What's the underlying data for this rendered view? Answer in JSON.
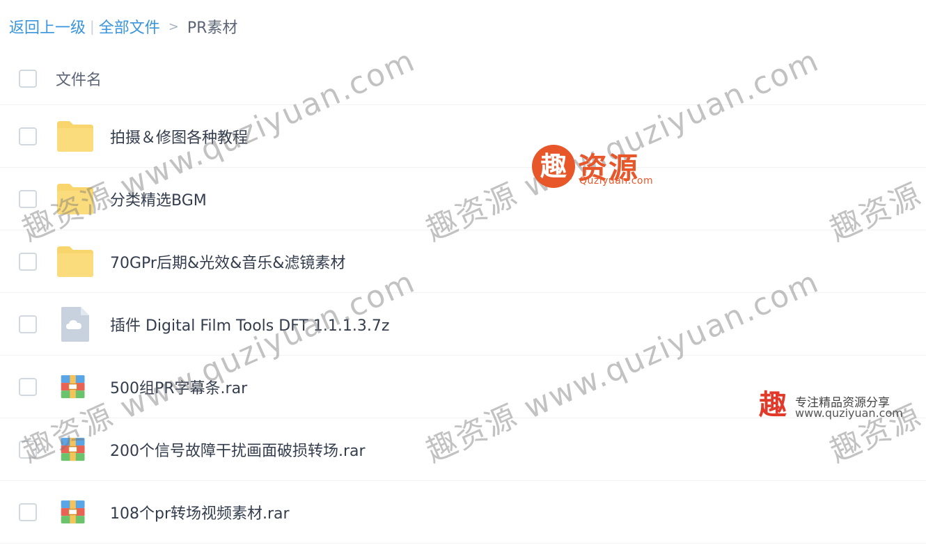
{
  "breadcrumb": {
    "back": "返回上一级",
    "divider": "|",
    "all_files": "全部文件",
    "arrow": ">",
    "current": "PR素材"
  },
  "header": {
    "column_name": "文件名"
  },
  "files": [
    {
      "name": "拍摄＆修图各种教程",
      "type": "folder"
    },
    {
      "name": "分类精选BGM",
      "type": "folder"
    },
    {
      "name": "70GPr后期&光效&音乐&滤镜素材",
      "type": "folder"
    },
    {
      "name": "插件 Digital Film Tools DFT 1.1.1.3.7z",
      "type": "cloud-file"
    },
    {
      "name": "500组PR字幕条.rar",
      "type": "archive"
    },
    {
      "name": "200个信号故障干扰画面破损转场.rar",
      "type": "archive"
    },
    {
      "name": "108个pr转场视频素材.rar",
      "type": "archive"
    }
  ],
  "watermark": {
    "cn": "趣资源",
    "url": "www.quziyuan.com"
  },
  "logo_big": {
    "glyph": "趣",
    "cn": "资源",
    "en": "Quziyuan.com"
  },
  "logo_small": {
    "glyph": "趣",
    "slogan": "专注精品资源分享",
    "url": "www.quziyuan.com"
  },
  "colors": {
    "link": "#3a95dc",
    "folder": "#f8d56d",
    "brand": "#e8572a"
  }
}
